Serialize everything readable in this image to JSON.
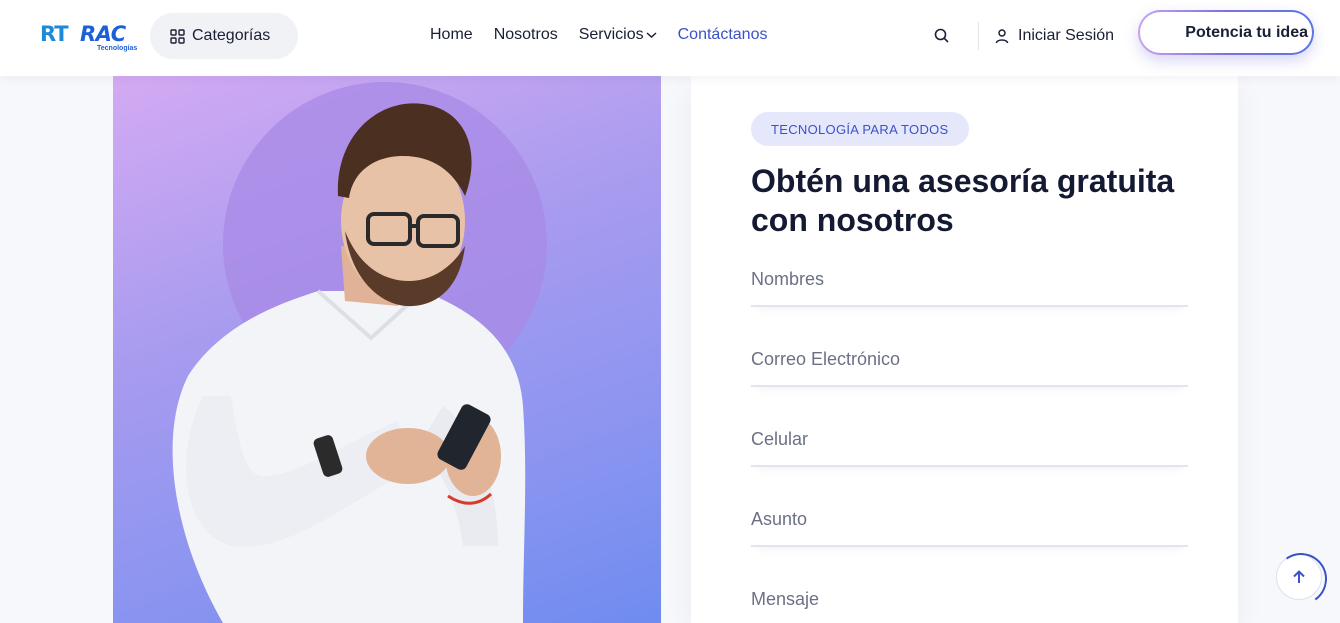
{
  "header": {
    "logo": {
      "mark": "RT",
      "name": "RAC",
      "sub": "Tecnologías"
    },
    "categories_label": "Categorías",
    "nav": [
      {
        "label": "Home",
        "active": false
      },
      {
        "label": "Nosotros",
        "active": false
      },
      {
        "label": "Servicios",
        "active": false,
        "has_dropdown": true
      },
      {
        "label": "Contáctanos",
        "active": true
      }
    ],
    "login_label": "Iniciar Sesión",
    "cta_label": "Potencia tu idea",
    "icons": {
      "categories": "grid-icon",
      "search": "search-icon",
      "user": "user-icon",
      "dropdown": "chevron-down-icon"
    }
  },
  "form": {
    "tag": "TECNOLOGÍA PARA TODOS",
    "title": "Obtén una asesoría gratuita con nosotros",
    "fields": [
      {
        "placeholder": "Nombres"
      },
      {
        "placeholder": "Correo Electrónico"
      },
      {
        "placeholder": "Celular"
      },
      {
        "placeholder": "Asunto"
      },
      {
        "placeholder": "Mensaje"
      }
    ]
  },
  "scroll_to_top": {
    "icon": "arrow-up-icon"
  },
  "colors": {
    "accent": "#3a52c8",
    "tag_bg": "#e5e8fb",
    "hero_gradient_start": "#d4aaf3",
    "hero_gradient_end": "#6f8cf0"
  }
}
